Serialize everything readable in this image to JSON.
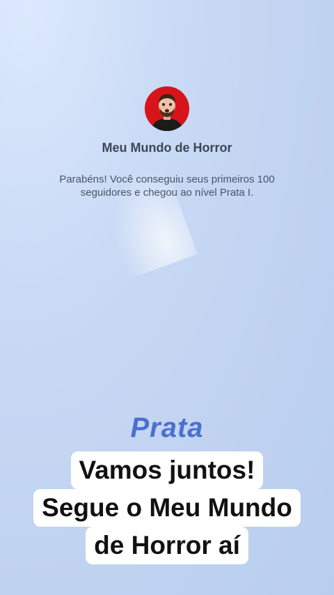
{
  "profile": {
    "name": "Meu Mundo de Horror",
    "message": "Parabéns! Você conseguiu seus primeiros 100 seguidores e chegou ao nível Prata I."
  },
  "level": "Prata",
  "caption": {
    "lines": [
      "Vamos juntos!",
      "Segue o Meu Mundo",
      "de Horror aí"
    ]
  },
  "colors": {
    "avatar_background": "#d8141b",
    "level_text": "#4a70cf",
    "caption_background": "#ffffff"
  }
}
